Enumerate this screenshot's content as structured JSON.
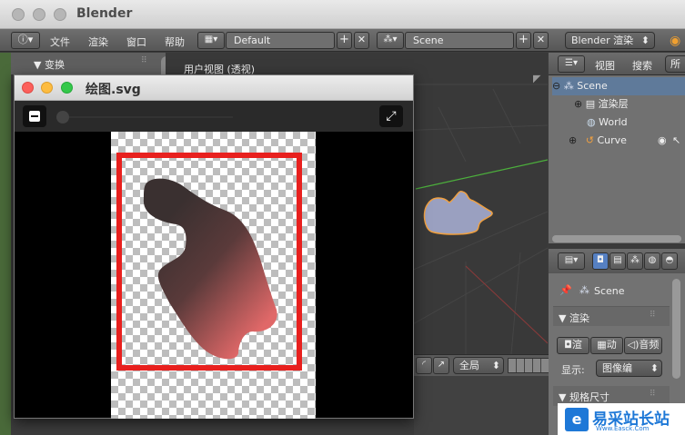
{
  "app": {
    "title": "Blender"
  },
  "menu": {
    "info_icon": "info-icon",
    "items": [
      "文件",
      "渲染",
      "窗口",
      "帮助"
    ]
  },
  "screen_selector": {
    "value": "Default"
  },
  "scene_selector": {
    "value": "Scene"
  },
  "engine_selector": {
    "value": "Blender 渲染"
  },
  "toolshelf": {
    "header": "▼ 变换"
  },
  "viewport": {
    "label": "用户视图 (透视)",
    "pivot_value": "全局"
  },
  "viewer": {
    "title": "绘图.svg"
  },
  "outliner": {
    "tabs": [
      "视图",
      "搜索",
      "所"
    ],
    "rows": [
      {
        "label": "Scene"
      },
      {
        "label": "渲染层"
      },
      {
        "label": "World"
      },
      {
        "label": "Curve"
      }
    ]
  },
  "properties": {
    "scene_label": "Scene",
    "render_section": "▼ 渲染",
    "render_buttons": [
      "渲",
      "动",
      "音频"
    ],
    "display_label": "显示:",
    "display_value": "图像编",
    "dimensions_section": "▼ 规格尺寸"
  },
  "watermark": {
    "text": "易采站长站",
    "sub": "Www.Easck.Com"
  },
  "colors": {
    "frame_red": "#e8201e",
    "shape_dark": "#4a3a38",
    "shape_light": "#d96060",
    "selected_outline": "#f0a040"
  }
}
